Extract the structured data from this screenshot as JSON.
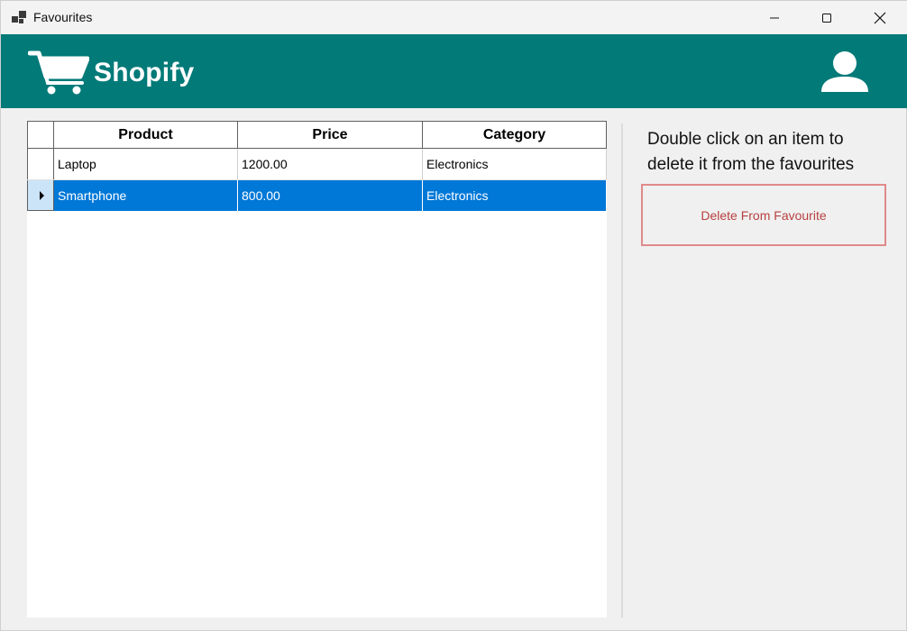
{
  "window": {
    "title": "Favourites",
    "icon": "app-window-icon",
    "controls": {
      "minimize": "minimize-icon",
      "maximize": "maximize-icon",
      "close": "close-icon"
    }
  },
  "header": {
    "brand": "Shopify",
    "background": "#017a78",
    "cart_icon": "shopping-cart-icon",
    "user_icon": "user-profile-icon"
  },
  "grid": {
    "columns": [
      "Product",
      "Price",
      "Category"
    ],
    "rows": [
      {
        "product": "Laptop",
        "price": "1200.00",
        "category": "Electronics",
        "selected": false
      },
      {
        "product": "Smartphone",
        "price": "800.00",
        "category": "Electronics",
        "selected": true
      }
    ],
    "selection_color": "#0078d7"
  },
  "side_panel": {
    "instructions": "Double click on an item to delete it from the favourites",
    "delete_button": "Delete From Favourite"
  }
}
